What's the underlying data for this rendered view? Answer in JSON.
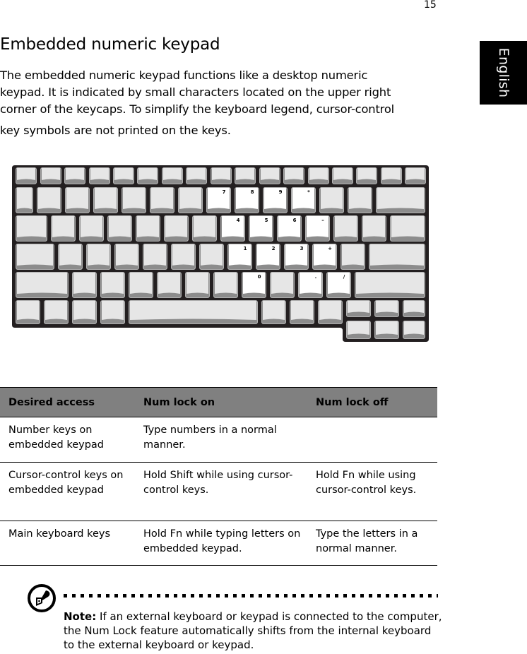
{
  "page": {
    "page_number": "15",
    "language_tab": "English",
    "title": "Embedded numeric keypad",
    "intro_lines": [
      "The embedded numeric keypad functions like a desktop numeric",
      "keypad. It is indicated by small characters located on the upper right",
      "corner of the keycaps. To simplify the keyboard legend, cursor-control",
      "key symbols are not printed on the keys."
    ]
  },
  "keyboard": {
    "figure_name": "embedded keypad keyboard illustration",
    "keypad_legends": {
      "row2": [
        "7",
        "8",
        "9",
        "*"
      ],
      "row3": [
        "4",
        "5",
        "6",
        "–"
      ],
      "row4": [
        "1",
        "2",
        "3",
        "+"
      ],
      "row5": [
        "0",
        ".",
        "/"
      ]
    },
    "colors": {
      "frame": "#231f20",
      "key_face": "#e6e6e6",
      "key_shadow": "#8c8c8c",
      "keypad_face": "#ffffff"
    }
  },
  "table": {
    "headers": [
      "Desired access",
      "Num lock on",
      "Num lock off"
    ],
    "rows": [
      [
        "Number keys on embedded keypad",
        "Type numbers in a normal manner.",
        ""
      ],
      [
        "Cursor-control keys on embedded keypad",
        "Hold Shift while using cursor-control keys.",
        "Hold Fn while using cursor-control keys."
      ],
      [
        "Main keyboard keys",
        "Hold Fn while typing letters on embedded keypad.",
        "Type the letters in a normal manner."
      ]
    ]
  },
  "note": {
    "icon": "note-pen-icon",
    "label": "Note:",
    "text": " If an external keyboard or keypad is connected to the computer, the Num Lock feature automatically shifts from the internal keyboard to the external keyboard or keypad."
  }
}
